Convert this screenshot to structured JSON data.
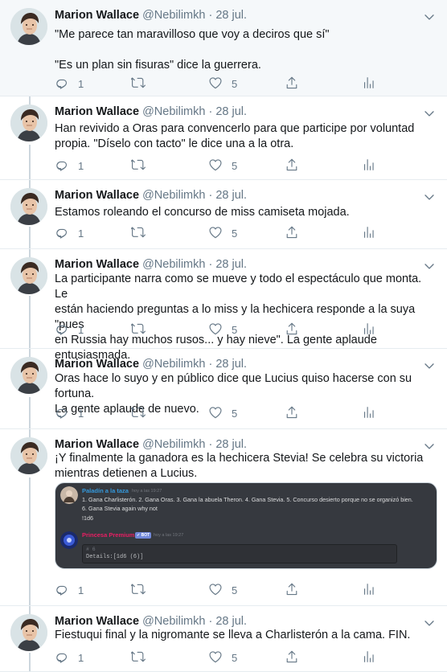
{
  "author": {
    "name": "Marion Wallace",
    "handle": "@Nebilimkh",
    "separator": "·",
    "date": "28 jul."
  },
  "tweets": [
    {
      "lines": [
        "\"Me parece tan maravilloso que voy a deciros que sí\"",
        "",
        "\"Es un plan sin fisuras\" dice la guerrera."
      ],
      "replies": "1",
      "likes": "5"
    },
    {
      "lines": [
        "Han revivido a Oras para convencerlo para que participe por voluntad",
        "propia. \"Díselo con tacto\" le dice una a la otra."
      ],
      "replies": "1",
      "likes": "5"
    },
    {
      "lines": [
        "Estamos roleando el concurso de miss camiseta mojada."
      ],
      "replies": "1",
      "likes": "5"
    },
    {
      "lines": [
        "La participante narra como se mueve y todo el espectáculo que monta. Le",
        "están haciendo preguntas a lo miss y la hechicera responde a la suya \"pues",
        "en Russia hay muchos rusos... y hay nieve\". La gente aplaude entusiasmada."
      ],
      "replies": "1",
      "likes": "5"
    },
    {
      "lines": [
        "Oras hace lo suyo y en público dice que Lucius quiso hacerse con su fortuna.",
        "La gente aplaude de nuevo."
      ],
      "replies": "1",
      "likes": "5"
    },
    {
      "lines": [
        "¡Y finalmente la ganadora es la hechicera Stevia! Se celebra su victoria",
        "mientras detienen a Lucius."
      ],
      "replies": "1",
      "likes": "5"
    },
    {
      "lines": [
        "Fiestuqui final y la nigromante se lleva a Charlisterón a la cama. FIN."
      ],
      "replies": "1",
      "likes": "5"
    }
  ],
  "embed": {
    "user1": {
      "name": "Paladín a la taza",
      "time": "hoy a las 19:27",
      "name_color": "#3498db"
    },
    "msg1_line1": "1. Gana Charlisterón. 2. Gana Oras. 3. Gana la abuela Theron. 4. Gana Stevia. 5. Concurso desierto porque no se organizó bien.",
    "msg1_line2": "6. Gana Stevia again why not",
    "msg1_line3": "!1d6",
    "user2": {
      "name": "Princesa Premium",
      "badge": "✓ BOT",
      "time": "hoy a las 19:27",
      "name_color": "#e91e63"
    },
    "code_line1": "# 6",
    "code_line2": "Details:[1d6 (6)]"
  },
  "icons": {
    "reply": "reply-icon",
    "retweet": "retweet-icon",
    "like": "heart-icon",
    "share": "share-icon",
    "analytics": "analytics-icon",
    "menu": "chevron-down-icon"
  },
  "colors": {
    "text": "#14171a",
    "muted": "#657786",
    "thread": "#ccd6dd",
    "discord_bg": "#36393f"
  }
}
